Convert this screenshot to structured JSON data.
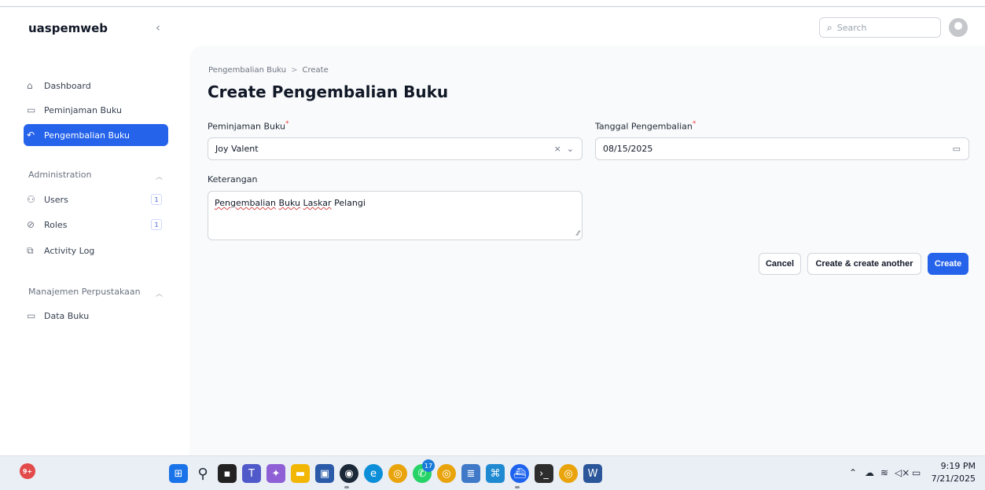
{
  "app": {
    "name": "uaspemweb",
    "collapse_icon": "chevron-left-icon"
  },
  "search": {
    "placeholder": "Search"
  },
  "sidebar": {
    "items": [
      {
        "label": "Dashboard",
        "icon": "home-icon",
        "active": false
      },
      {
        "label": "Peminjaman Buku",
        "icon": "book-open-icon",
        "active": false
      },
      {
        "label": "Pengembalian Buku",
        "icon": "return-arrow-icon",
        "active": true
      }
    ],
    "groups": [
      {
        "label": "Administration",
        "items": [
          {
            "label": "Users",
            "icon": "users-icon",
            "badge": "1"
          },
          {
            "label": "Roles",
            "icon": "shield-check-icon",
            "badge": "1"
          },
          {
            "label": "Activity Log",
            "icon": "document-copy-icon"
          }
        ]
      },
      {
        "label": "Manajemen Perpustakaan",
        "items": [
          {
            "label": "Data Buku",
            "icon": "book-open-icon"
          }
        ]
      }
    ]
  },
  "breadcrumb": {
    "parent": "Pengembalian Buku",
    "separator": ">",
    "current": "Create"
  },
  "page": {
    "title": "Create Pengembalian Buku"
  },
  "form": {
    "peminjaman": {
      "label": "Peminjaman Buku",
      "value": "Joy Valent",
      "required": "*"
    },
    "tanggal": {
      "label": "Tanggal Pengembalian",
      "value": "08/15/2025",
      "required": "*"
    },
    "keterangan": {
      "label": "Keterangan",
      "value_words": [
        "Pengembalian",
        "Buku",
        "Laskar",
        "Pelangi"
      ]
    }
  },
  "actions": {
    "cancel": "Cancel",
    "create_another": "Create & create another",
    "create": "Create"
  },
  "taskbar": {
    "notification_count": "9+",
    "whatsapp_badge": "17",
    "clock_time": "9:19 PM",
    "clock_date": "7/21/2025"
  },
  "colors": {
    "accent": "#2563eb",
    "required": "#ef4444"
  }
}
